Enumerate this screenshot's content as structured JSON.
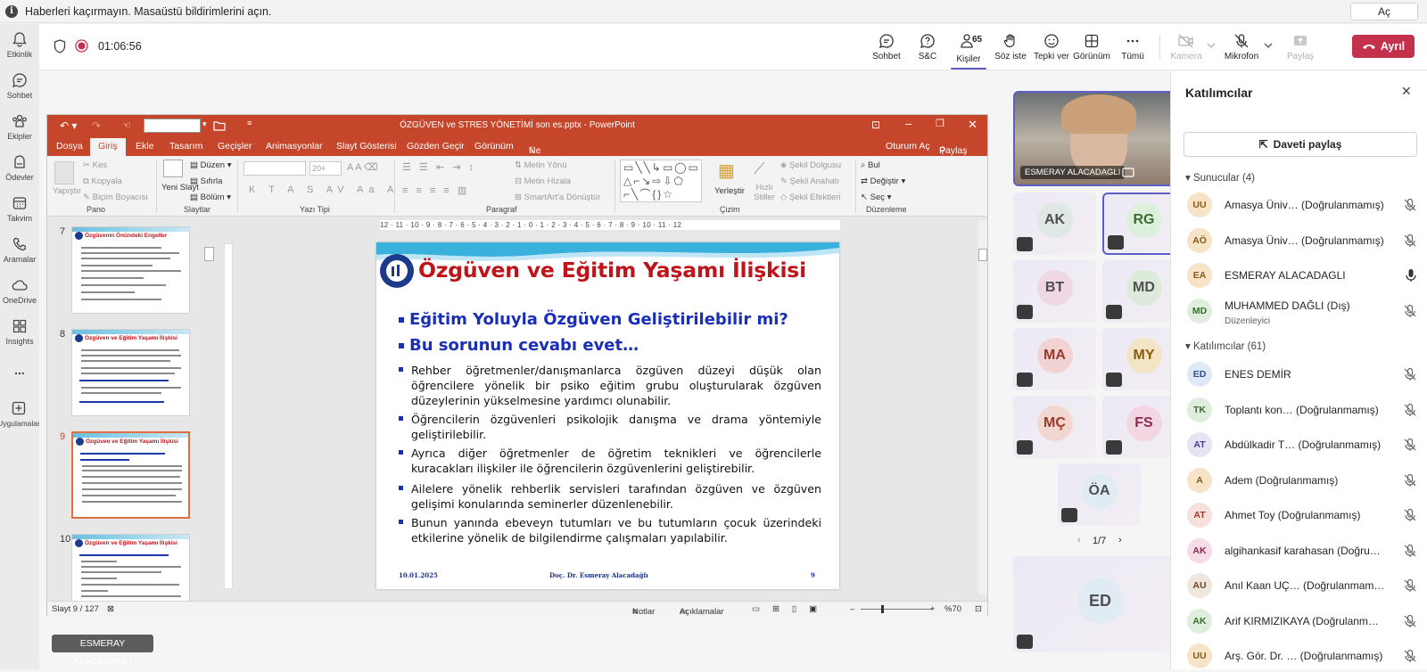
{
  "notification": {
    "text": "Haberleri kaçırmayın. Masaüstü bildirimlerini açın.",
    "button": "Aç"
  },
  "rail": [
    {
      "label": "Etkinlik",
      "icon": "bell-icon"
    },
    {
      "label": "Sohbet",
      "icon": "chat-icon"
    },
    {
      "label": "Ekipler",
      "icon": "teams-icon"
    },
    {
      "label": "Ödevler",
      "icon": "backpack-icon"
    },
    {
      "label": "Takvim",
      "icon": "calendar-icon"
    },
    {
      "label": "Aramalar",
      "icon": "phone-icon"
    },
    {
      "label": "OneDrive",
      "icon": "cloud-icon"
    },
    {
      "label": "Insights",
      "icon": "insights-icon"
    },
    {
      "label": "...",
      "icon": "more-icon"
    },
    {
      "label": "Uygulamalar",
      "icon": "apps-icon"
    }
  ],
  "meeting": {
    "timer": "01:06:56",
    "toolbar": {
      "chat": "Sohbet",
      "qa": "S&C",
      "people": "Kişiler",
      "people_count": "65",
      "raise": "Söz iste",
      "react": "Tepki ver",
      "view": "Görünüm",
      "more": "Tümü",
      "camera": "Kamera",
      "mic": "Mikrofon",
      "share": "Paylaş",
      "leave": "Ayrıl"
    }
  },
  "ppt": {
    "window_title": "ÖZGÜVEN ve STRES YÖNETİMİ son es.pptx - PowerPoint",
    "tabs": [
      "Dosya",
      "Giriş",
      "Ekle",
      "Tasarım",
      "Geçişler",
      "Animasyonlar",
      "Slayt Gösterisi",
      "Gözden Geçir",
      "Görünüm"
    ],
    "tell_me": "Ne yapmak istediğinizi söyleyin...",
    "signin": "Oturum Aç",
    "share": "Paylaş",
    "ribbon": {
      "paste": "Yapıştır",
      "cut": "Kes",
      "copy": "Kopyala",
      "format_painter": "Biçim Boyacısı",
      "new_slide": "Yeni Slayt",
      "layout": "Düzen",
      "reset": "Sıfırla",
      "section": "Bölüm",
      "font_size": "20+",
      "text_direction": "Metin Yönü",
      "align_text": "Metin Hizala",
      "smartart": "SmartArt'a Dönüştür",
      "arrange": "Yerleştir",
      "quick_styles": "Hızlı Stiller",
      "shape_fill": "Şekil Dolgusu",
      "shape_outline": "Şekil Anahatı",
      "shape_effects": "Şekil Efektleri",
      "find": "Bul",
      "replace": "Değiştir",
      "select": "Seç",
      "groups": {
        "clipboard": "Pano",
        "slides": "Slaytlar",
        "font": "Yazı Tipi",
        "paragraph": "Paragraf",
        "drawing": "Çizim",
        "editing": "Düzenleme"
      }
    },
    "ruler": "12 · 11 · 10 · 9 · 8 · 7 · 6 · 5 · 4 · 3 · 2 · 1 · 0 · 1 · 2 · 3 · 4 · 5 · 6 · 7 · 8 · 9 · 10 · 11 · 12",
    "thumbnails": [
      {
        "num": "7",
        "title": "Özgüvenin Önündeki Engeller"
      },
      {
        "num": "8",
        "title": "Özgüven ve Eğitim Yaşamı İlişkisi"
      },
      {
        "num": "9",
        "title": "Özgüven ve Eğitim Yaşamı İlişkisi"
      },
      {
        "num": "10",
        "title": "Özgüven ve Eğitim Yaşamı İlişkisi"
      }
    ],
    "slide": {
      "title": "Özgüven ve Eğitim Yaşamı İlişkisi",
      "q1": "Eğitim  Yoluyla Özgüven Geliştirilebilir mi?",
      "q2": "Bu sorunun cevabı evet…",
      "bullets": [
        "Rehber öğretmenler/danışmanlarca özgüven düzeyi düşük olan öğrencilere yönelik bir psiko eğitim grubu oluşturularak özgüven düzeylerinin yükselmesine yardımcı olunabilir.",
        "Öğrencilerin özgüvenleri psikolojik danışma ve drama yöntemiyle geliştirilebilir.",
        "Ayrıca diğer öğretmenler de öğretim teknikleri ve öğrencilerle kuracakları ilişkiler ile öğrencilerin özgüvenlerini geliştirebilir.",
        "Ailelere yönelik rehberlik servisleri tarafından özgüven ve özgüven gelişimi konularında seminerler düzenlenebilir.",
        "Bunun yanında ebeveyn tutumları ve bu tutumların çocuk üzerindeki etkilerine yönelik de bilgilendirme çalışmaları yapılabilir."
      ],
      "date": "10.01.2025",
      "author": "Doç. Dr. Esmeray Alacadağlı",
      "page": "9"
    },
    "status": {
      "slide_count": "Slayt 9 / 127",
      "notes": "Notlar",
      "comments": "Açıklamalar",
      "zoom": "%70"
    }
  },
  "presenter_label": "ESMERAY ALACADAGLI",
  "video": {
    "self_name": "ESMERAY ALACADAGLI",
    "tiles": [
      "AK",
      "RG",
      "BT",
      "MD",
      "MA",
      "MY",
      "MÇ",
      "FS",
      "ÖA"
    ],
    "page": "1/7",
    "bottom_tile": "ED"
  },
  "panel": {
    "title": "Katılımcılar",
    "invite": "Daveti paylaş",
    "presenters_header": "Sunucular (4)",
    "presenters": [
      {
        "initials": "UU",
        "name": "Amasya Üniv… (Doğrulanmamış)",
        "color": "#f6e3c8",
        "fg": "#8a5a12"
      },
      {
        "initials": "AÖ",
        "name": "Amasya Üniv… (Doğrulanmamış)",
        "color": "#f6e3c8",
        "fg": "#8a5a12"
      },
      {
        "initials": "EA",
        "name": "ESMERAY ALACADAGLI",
        "color": "#f6e3c8",
        "fg": "#8a5a12"
      },
      {
        "initials": "MD",
        "name": "MUHAMMED DAĞLI (Dış)",
        "sub": "Düzenleyici",
        "color": "#dfeedd",
        "fg": "#3b6b2d"
      }
    ],
    "attendees_header": "Katılımcılar (61)",
    "attendees": [
      {
        "initials": "ED",
        "name": "ENES DEMİR",
        "color": "#dfe8f6",
        "fg": "#2e4f8a"
      },
      {
        "initials": "TK",
        "name": "Toplantı kon… (Doğrulanmamış)",
        "color": "#dfeedd",
        "fg": "#3b6b2d"
      },
      {
        "initials": "AT",
        "name": "Abdülkadir T… (Doğrulanmamış)",
        "color": "#e6e3f3",
        "fg": "#4a3f8a"
      },
      {
        "initials": "A",
        "name": "Adem (Doğrulanmamış)",
        "color": "#f6e3c8",
        "fg": "#8a5a12"
      },
      {
        "initials": "AT",
        "name": "Ahmet Toy (Doğrulanmamış)",
        "color": "#f8e0dc",
        "fg": "#9a3a2a"
      },
      {
        "initials": "AK",
        "name": "algihankasif karahasan (Doğru…",
        "color": "#f6dce6",
        "fg": "#8a2a52"
      },
      {
        "initials": "AU",
        "name": "Anıl Kaan UÇ… (Doğrulanmamış)",
        "color": "#efe6dc",
        "fg": "#6b4a2a"
      },
      {
        "initials": "AK",
        "name": "Arif KIRMIZIKAYA (Doğrulanm…",
        "color": "#dfeedd",
        "fg": "#3b6b2d"
      },
      {
        "initials": "UU",
        "name": "Arş. Gör. Dr. … (Doğrulanmamış)",
        "color": "#f6e3c8",
        "fg": "#8a5a12"
      }
    ]
  }
}
